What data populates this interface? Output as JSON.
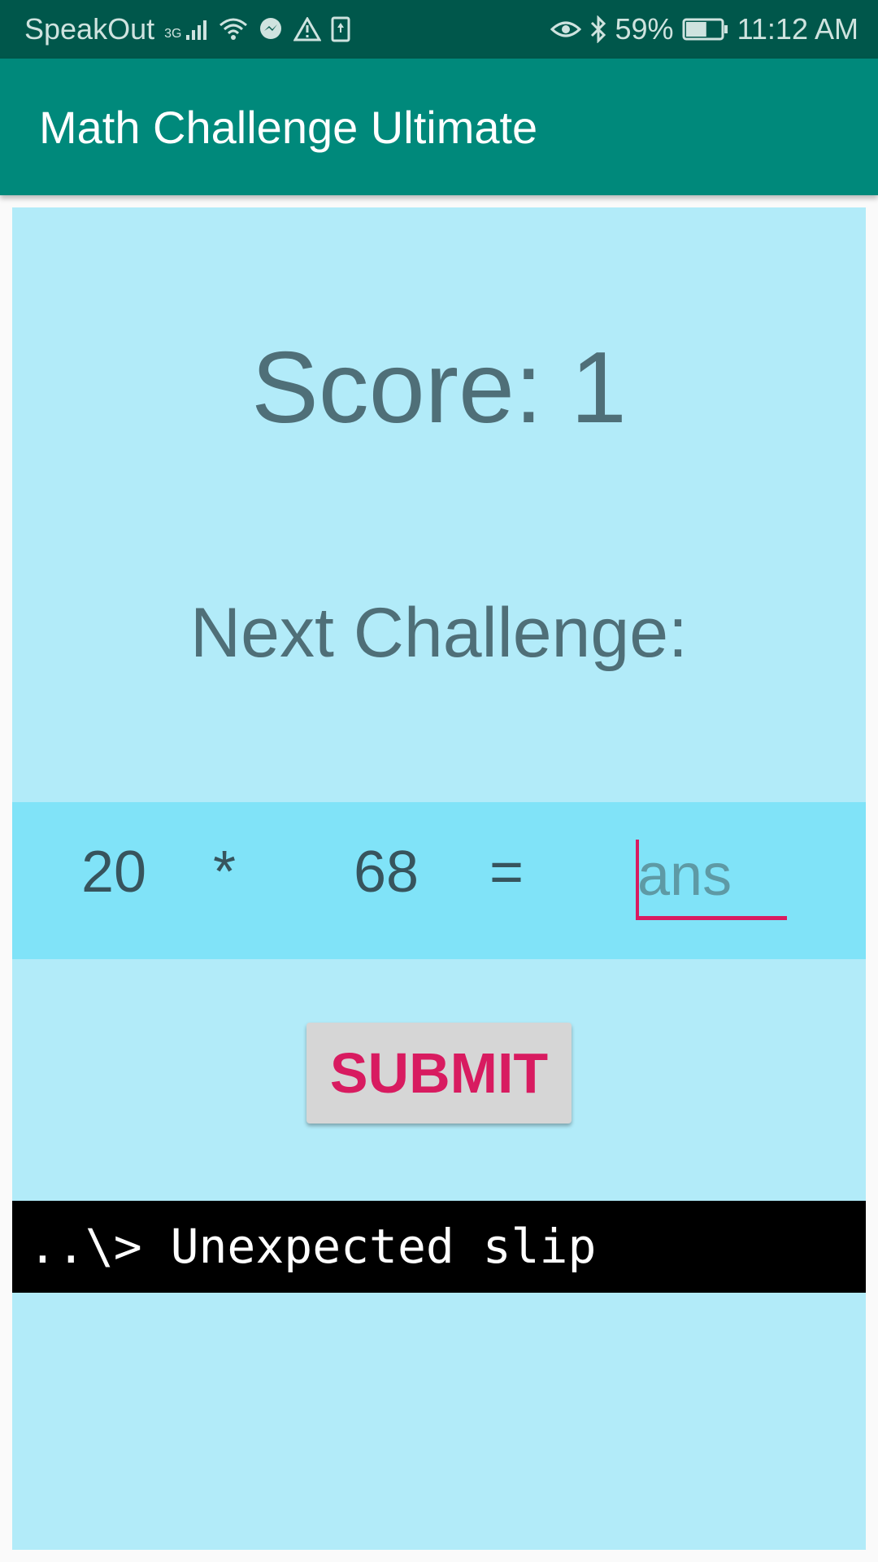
{
  "status_bar": {
    "carrier": "SpeakOut",
    "network_type": "3G",
    "icons_left": [
      "signal-icon",
      "wifi-icon",
      "messenger-icon",
      "warning-icon",
      "storage-icon"
    ],
    "icons_right": [
      "eye-icon",
      "bluetooth-icon",
      "battery-icon"
    ],
    "battery_percent": "59%",
    "battery_level": 0.59,
    "time": "11:12 AM"
  },
  "app_bar": {
    "title": "Math Challenge Ultimate",
    "color": "#00897b"
  },
  "main": {
    "score_text": "Score: 1",
    "next_challenge_label": "Next Challenge:",
    "challenge": {
      "operand_a": "20",
      "operator": "*",
      "operand_b": "68",
      "equals": "=",
      "answer_value": "",
      "answer_placeholder": "ans"
    },
    "submit_label": "SUBMIT",
    "terminal_message": "..\\> Unexpected slip"
  },
  "colors": {
    "background": "#b2ebf9",
    "challenge_row": "#80e3f8",
    "accent": "#d81b60",
    "status_bar": "#00574b"
  }
}
